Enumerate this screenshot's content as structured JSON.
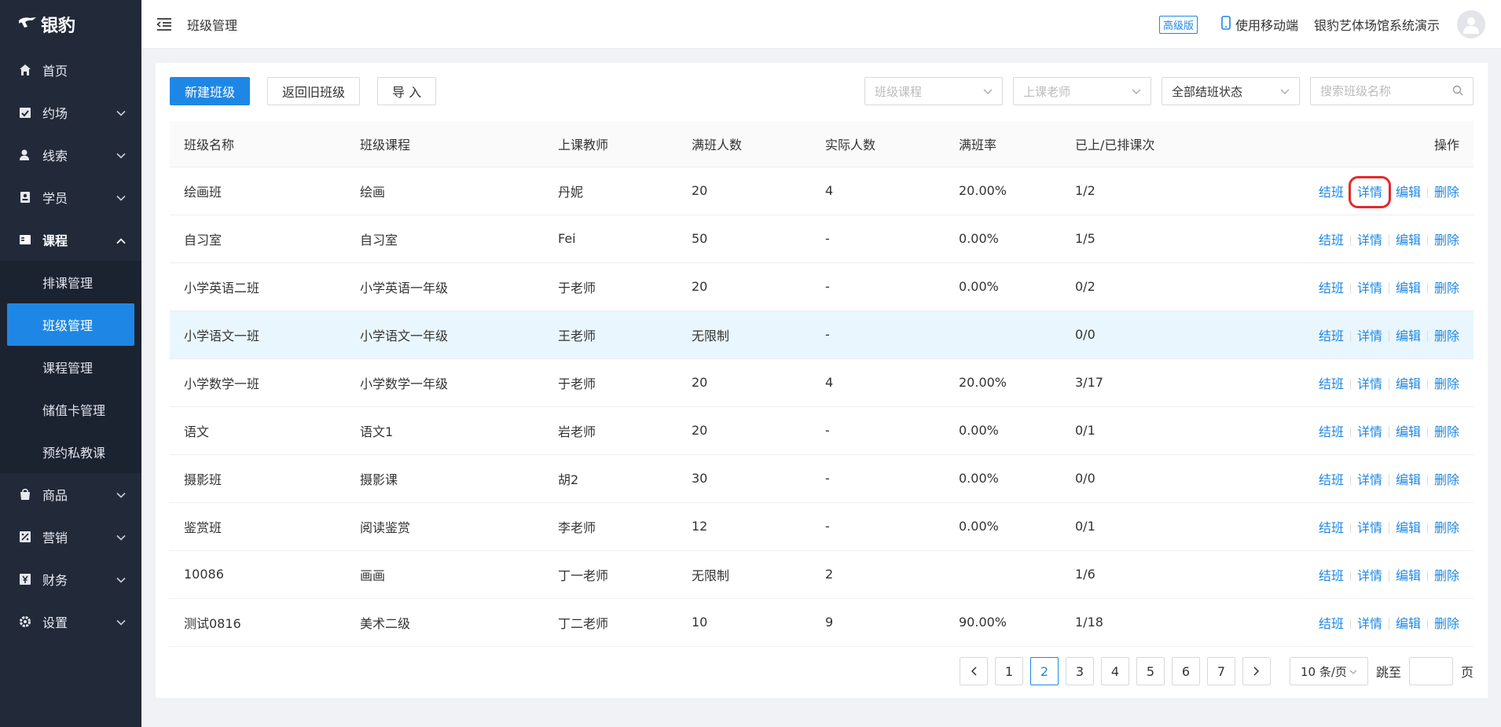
{
  "app": {
    "logo": "银豹"
  },
  "sidebar": {
    "items": [
      {
        "label": "首页",
        "icon": "home-icon",
        "expandable": false
      },
      {
        "label": "约场",
        "icon": "calendar-check-icon",
        "expandable": true
      },
      {
        "label": "线索",
        "icon": "user-icon",
        "expandable": true
      },
      {
        "label": "学员",
        "icon": "id-card-icon",
        "expandable": true
      },
      {
        "label": "课程",
        "icon": "book-icon",
        "expandable": true,
        "expanded": true
      },
      {
        "label": "商品",
        "icon": "bag-icon",
        "expandable": true
      },
      {
        "label": "营销",
        "icon": "percent-icon",
        "expandable": true
      },
      {
        "label": "财务",
        "icon": "yen-icon",
        "expandable": true
      },
      {
        "label": "设置",
        "icon": "gear-icon",
        "expandable": true
      }
    ],
    "course_sub": [
      {
        "label": "排课管理"
      },
      {
        "label": "班级管理",
        "active": true
      },
      {
        "label": "课程管理"
      },
      {
        "label": "储值卡管理"
      },
      {
        "label": "预约私教课"
      }
    ]
  },
  "header": {
    "title": "班级管理",
    "badge": "高级版",
    "mobile_label": "使用移动端",
    "org_name": "银豹艺体场馆系统演示"
  },
  "toolbar": {
    "new_label": "新建班级",
    "back_label": "返回旧班级",
    "import_label": "导 入"
  },
  "filters": {
    "course_placeholder": "班级课程",
    "teacher_placeholder": "上课老师",
    "status_value": "全部结班状态",
    "search_placeholder": "搜索班级名称"
  },
  "table": {
    "columns": [
      "班级名称",
      "班级课程",
      "上课教师",
      "满班人数",
      "实际人数",
      "满班率",
      "已上/已排课次",
      "操作"
    ],
    "actions": [
      "结班",
      "详情",
      "编辑",
      "删除"
    ],
    "rows": [
      [
        "绘画班",
        "绘画",
        "丹妮",
        "20",
        "4",
        "20.00%",
        "1/2"
      ],
      [
        "自习室",
        "自习室",
        "Fei",
        "50",
        "-",
        "0.00%",
        "1/5"
      ],
      [
        "小学英语二班",
        "小学英语一年级",
        "于老师",
        "20",
        "-",
        "0.00%",
        "0/2"
      ],
      [
        "小学语文一班",
        "小学语文一年级",
        "王老师",
        "无限制",
        "-",
        "",
        "0/0"
      ],
      [
        "小学数学一班",
        "小学数学一年级",
        "于老师",
        "20",
        "4",
        "20.00%",
        "3/17"
      ],
      [
        "语文",
        "语文1",
        "岩老师",
        "20",
        "-",
        "0.00%",
        "0/1"
      ],
      [
        "摄影班",
        "摄影课",
        "胡2",
        "30",
        "-",
        "0.00%",
        "0/0"
      ],
      [
        "鉴赏班",
        "阅读鉴赏",
        "李老师",
        "12",
        "-",
        "0.00%",
        "0/1"
      ],
      [
        "10086",
        "画画",
        "丁一老师",
        "无限制",
        "2",
        "",
        "1/6"
      ],
      [
        "测试0816",
        "美术二级",
        "丁二老师",
        "10",
        "9",
        "90.00%",
        "1/18"
      ]
    ]
  },
  "pagination": {
    "pages": [
      "1",
      "2",
      "3",
      "4",
      "5",
      "6",
      "7"
    ],
    "current": "2",
    "page_size": "10 条/页",
    "jump_label": "跳至",
    "page_unit": "页"
  },
  "colors": {
    "accent": "#1e87e5",
    "sidebar": "#222a3a",
    "highlight_row": "#e9f6fd",
    "annotation": "#e32a2a"
  }
}
